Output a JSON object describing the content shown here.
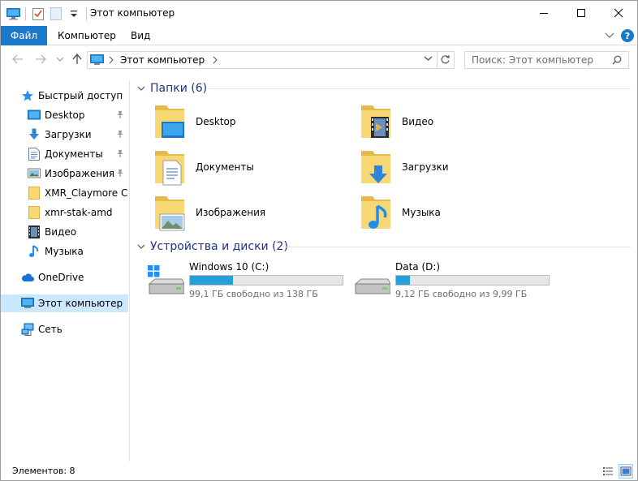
{
  "window": {
    "title": "Этот компьютер",
    "controls": [
      "minimize",
      "maximize",
      "close"
    ]
  },
  "quick_access_toolbar": {
    "icons": [
      "computer-icon",
      "properties-icon",
      "new-folder-icon",
      "customize-dropdown-icon"
    ]
  },
  "ribbon": {
    "file_tab": "Файл",
    "tabs": [
      "Компьютер",
      "Вид"
    ]
  },
  "navigation": {
    "address": "Этот компьютер",
    "search_placeholder": "Поиск: Этот компьютер"
  },
  "sidebar": {
    "quick_access": "Быстрый доступ",
    "quick_items": [
      {
        "label": "Desktop",
        "icon": "desktop-icon",
        "pinned": true
      },
      {
        "label": "Загрузки",
        "icon": "downloads-icon",
        "pinned": true
      },
      {
        "label": "Документы",
        "icon": "documents-icon",
        "pinned": true
      },
      {
        "label": "Изображения",
        "icon": "pictures-icon",
        "pinned": true
      },
      {
        "label": "XMR_Claymore Cry",
        "icon": "folder-icon",
        "pinned": false
      },
      {
        "label": "xmr-stak-amd",
        "icon": "folder-icon",
        "pinned": false
      },
      {
        "label": "Видео",
        "icon": "videos-icon",
        "pinned": false
      },
      {
        "label": "Музыка",
        "icon": "music-icon",
        "pinned": false
      }
    ],
    "onedrive": "OneDrive",
    "this_pc": "Этот компьютер",
    "network": "Сеть"
  },
  "content": {
    "folders_header": "Папки (6)",
    "folders": [
      {
        "label": "Desktop",
        "icon": "desktop-folder-icon"
      },
      {
        "label": "Видео",
        "icon": "videos-folder-icon"
      },
      {
        "label": "Документы",
        "icon": "documents-folder-icon"
      },
      {
        "label": "Загрузки",
        "icon": "downloads-folder-icon"
      },
      {
        "label": "Изображения",
        "icon": "pictures-folder-icon"
      },
      {
        "label": "Музыка",
        "icon": "music-folder-icon"
      }
    ],
    "drives_header": "Устройства и диски (2)",
    "drives": [
      {
        "name": "Windows 10 (C:)",
        "free": "99,1 ГБ свободно из 138 ГБ",
        "used_fraction": 0.28,
        "icon": "system-drive-icon"
      },
      {
        "name": "Data (D:)",
        "free": "9,12 ГБ свободно из 9,99 ГБ",
        "used_fraction": 0.09,
        "icon": "drive-icon"
      }
    ]
  },
  "status": {
    "items_count": "Элементов: 8"
  },
  "colors": {
    "accent": "#1979ca",
    "drive_bar": "#26a0da",
    "selection": "#cce8ff",
    "group_header": "#1e3287",
    "folder": "#f8d775"
  }
}
